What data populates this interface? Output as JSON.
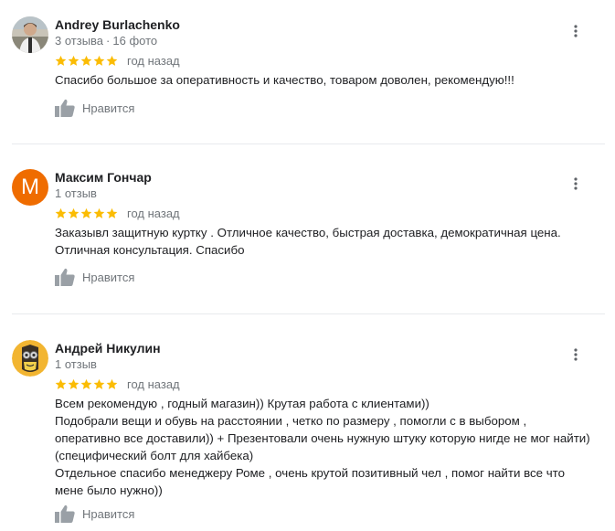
{
  "reviews": [
    {
      "author": "Andrey Burlachenko",
      "reviews_count": "3 отзыва",
      "photos_count": "16 фото",
      "separator": "·",
      "rating": 5,
      "date": "год назад",
      "text": [
        "Спасибо большое за оперативность и качество, товаром доволен, рекомендую!!!"
      ],
      "like_label": "Нравится"
    },
    {
      "author": "Максим Гончар",
      "avatar_letter": "M",
      "reviews_count": "1 отзыв",
      "rating": 5,
      "date": "год назад",
      "text": [
        "Заказывл защитную куртку . Отличное качество, быстрая доставка, демократичная цена. Отличная консультация. Спасибо"
      ],
      "like_label": "Нравится"
    },
    {
      "author": "Андрей Никулин",
      "reviews_count": "1 отзыв",
      "rating": 5,
      "date": "год назад",
      "text": [
        "Всем рекомендую , годный магазин)) Крутая работа с клиентами))",
        "Подобрали вещи и обувь на расстоянии , четко по размеру , помогли с в выбором , оперативно все доставили)) + Презентовали очень нужную штуку которую нигде не мог найти) (специфический болт для хайбека)",
        "Отдельное спасибо менеджеру Роме , очень крутой позитивный чел , помог найти все что мене было нужно))"
      ],
      "like_label": "Нравится"
    }
  ],
  "colors": {
    "star": "#fbbc04",
    "letter_avatar_bg": "#ef6c00",
    "secondary_text": "#70757a",
    "divider": "#e8eaed",
    "icon_gray": "#9aa0a6"
  },
  "icons": {
    "more": "more-vert-icon",
    "like": "thumb-up-icon",
    "star": "star-icon"
  }
}
